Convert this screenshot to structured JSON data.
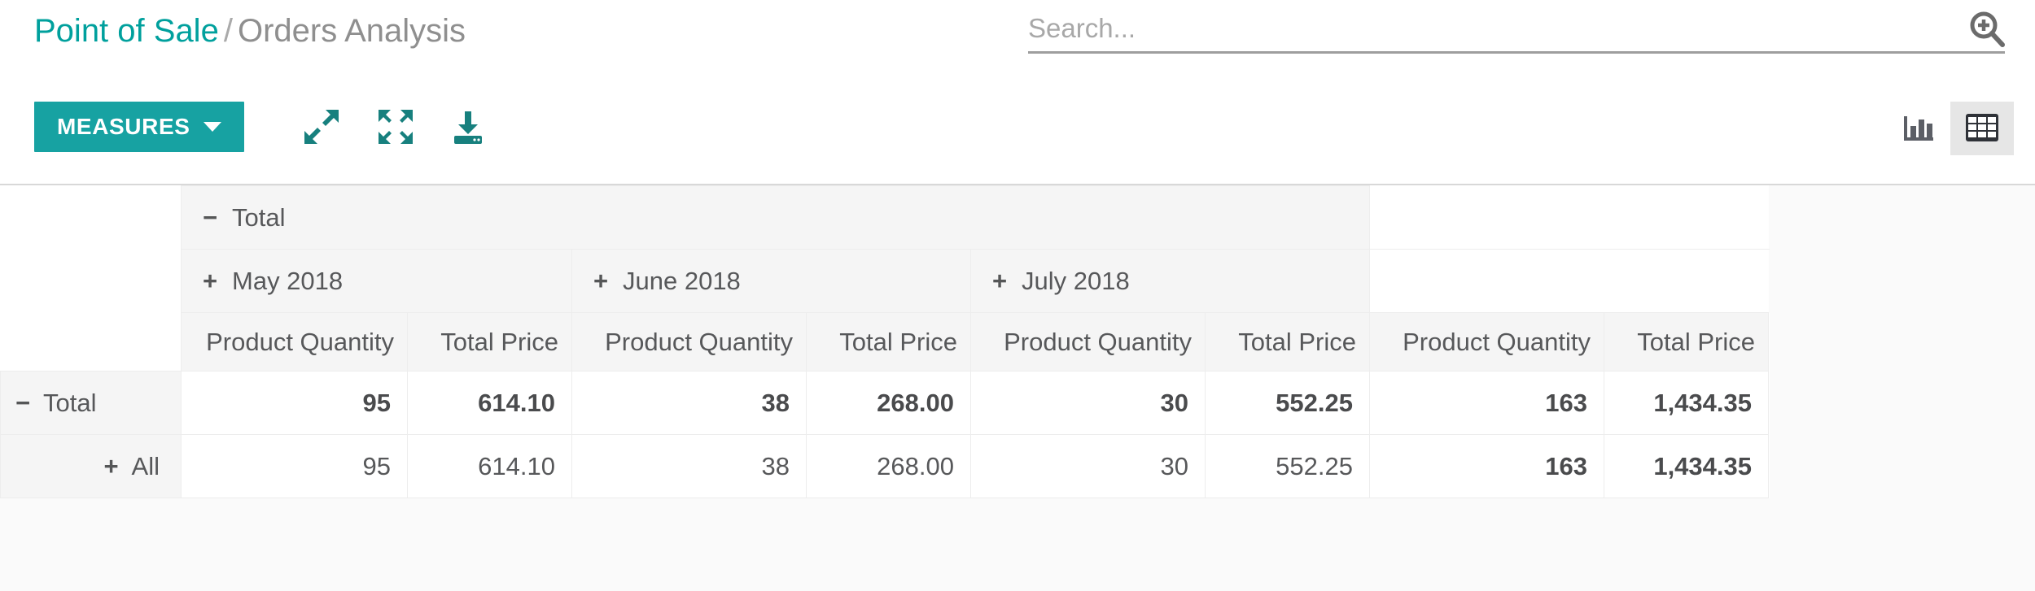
{
  "breadcrumb": {
    "root": "Point of Sale",
    "separator": "/",
    "current": "Orders Analysis"
  },
  "search": {
    "placeholder": "Search...",
    "value": "",
    "icon": "search-plus-icon"
  },
  "toolbar": {
    "measures_label": "MEASURES",
    "icons": [
      {
        "name": "expand-arrows-icon",
        "title": "Expand"
      },
      {
        "name": "collapse-arrows-icon",
        "title": "Flip axis"
      },
      {
        "name": "download-icon",
        "title": "Download xlsx"
      }
    ]
  },
  "view_switcher": {
    "buttons": [
      {
        "name": "graph-view-button",
        "icon": "bar-chart-icon",
        "active": false
      },
      {
        "name": "pivot-view-button",
        "icon": "table-grid-icon",
        "active": true
      }
    ]
  },
  "accent_color": "#17a2a2",
  "pivot": {
    "col_group": {
      "label": "Total",
      "toggle": "−"
    },
    "col_headers": [
      {
        "label": "May 2018",
        "toggle": "+"
      },
      {
        "label": "June 2018",
        "toggle": "+"
      },
      {
        "label": "July 2018",
        "toggle": "+"
      }
    ],
    "measures": [
      "Product Quantity",
      "Total Price"
    ],
    "rows": [
      {
        "label": "Total",
        "toggle": "−",
        "level": 0,
        "is_total": true,
        "values": [
          "95",
          "614.10",
          "38",
          "268.00",
          "30",
          "552.25",
          "163",
          "1,434.35"
        ]
      },
      {
        "label": "All",
        "toggle": "+",
        "level": 1,
        "is_total": false,
        "values": [
          "95",
          "614.10",
          "38",
          "268.00",
          "30",
          "552.25",
          "163",
          "1,434.35"
        ]
      }
    ]
  }
}
